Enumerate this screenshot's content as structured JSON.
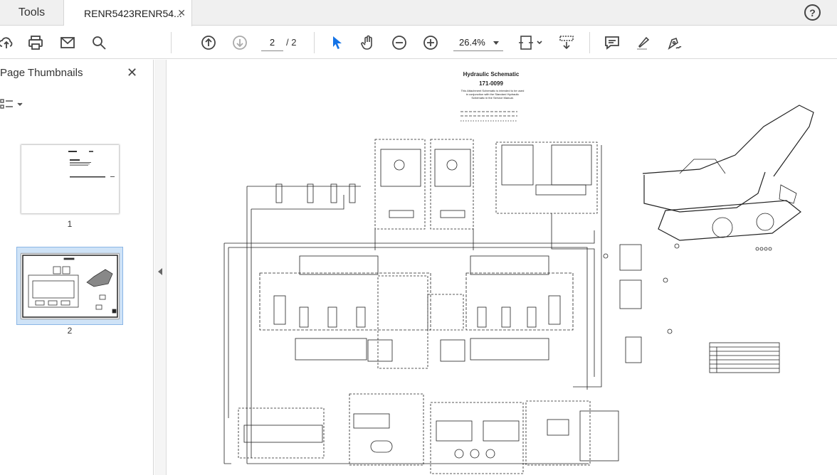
{
  "tabs": {
    "tools_label": "Tools",
    "document_label": "RENR5423RENR54...",
    "close_symbol": "✕"
  },
  "help_symbol": "?",
  "toolbar": {
    "current_page": "2",
    "total_pages": "/ 2",
    "zoom": "26.4%",
    "icons": [
      "upload-icon",
      "print-icon",
      "email-icon",
      "search-icon",
      "page-up-icon",
      "page-down-icon",
      "select-cursor-icon",
      "hand-icon",
      "zoom-out-icon",
      "zoom-in-icon",
      "fit-page-icon",
      "scroll-mode-icon",
      "comment-icon",
      "highlight-icon",
      "sign-icon"
    ]
  },
  "sidebar": {
    "title": "Page Thumbnails",
    "close_symbol": "✕",
    "thumbnails": [
      {
        "label": "1"
      },
      {
        "label": "2"
      }
    ]
  },
  "document": {
    "title": "Hydraulic Schematic",
    "number": "171-0099",
    "note": "This Attachment Schematic is intended to be used in conjunction with the Standard Hydraulic Schematic in the Service Manual."
  },
  "colors": {
    "accent": "#1473e6",
    "selected_thumb_bg": "#cfe3f7"
  }
}
